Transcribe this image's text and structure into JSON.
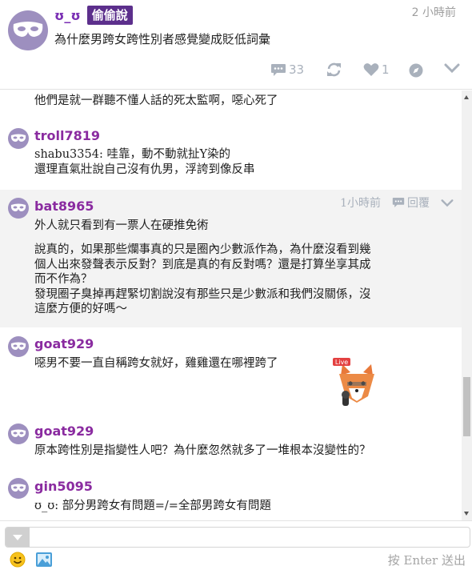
{
  "post": {
    "username": "ʊ_ʊ",
    "board": "偷偷說",
    "time": "2 小時前",
    "title": "為什麼男跨女跨性別者感覺變成貶低詞彙",
    "actions": {
      "comment_count": "33",
      "like_count": "1"
    }
  },
  "comments": [
    {
      "text": "他們是就一群聽不懂人話的死太監啊，噁心死了"
    },
    {
      "username": "troll7819",
      "text": "shabu3354: 哇靠，動不動就扯Y染的\n還理直氣壯說自己沒有仇男，浮誇到像反串"
    },
    {
      "username": "bat8965",
      "time": "1小時前",
      "reply_label": "回覆",
      "text": "外人就只看到有一票人在硬推免術"
    },
    {
      "text": "說真的，如果那些爛事真的只是圈內少數派作為，為什麼沒看到幾\n個人出來發聲表示反對？到底是真的有反對嗎？還是打算坐享其成\n而不作為？\n發現圈子臭掉再趕緊切割說沒有那些只是少數派和我們沒關係，沒\n這麼方便的好嗎～"
    },
    {
      "username": "goat929",
      "text": "噁男不要一直自稱跨女就好，雞雞還在哪裡跨了",
      "sticker_label": "Live"
    },
    {
      "username": "goat929",
      "text": "原本跨性別是指變性人吧？為什麼忽然就多了一堆根本沒變性的？"
    },
    {
      "username": "gin5095",
      "text": "ʊ_ʊ: 部分男跨女有問題=/=全部男跨女有問題"
    }
  ],
  "composer": {
    "placeholder": "",
    "send_hint": "按 Enter 送出"
  },
  "colors": {
    "username": "#8a2ba0",
    "board_badge": "#5c2f8c",
    "avatar": "#9d8fbf",
    "icon_gray": "#a9b1bc"
  },
  "icons": [
    "mask-icon",
    "comment-icon",
    "refresh-icon",
    "heart-icon",
    "compass-icon",
    "chevron-down-icon",
    "reply-icon",
    "emoji-icon",
    "image-icon"
  ]
}
